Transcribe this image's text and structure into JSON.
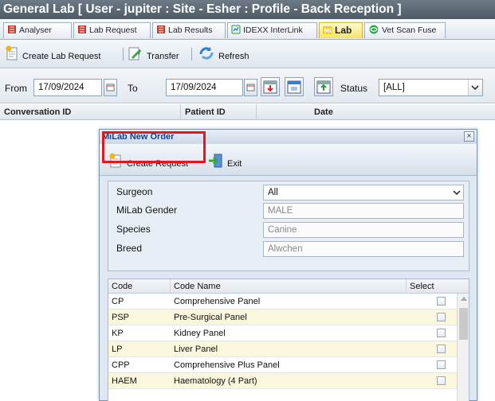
{
  "window": {
    "title": "General Lab [ User - jupiter : Site - Esher : Profile - Back Reception ]"
  },
  "tabs": [
    {
      "label": "Analyser"
    },
    {
      "label": "Lab Request"
    },
    {
      "label": "Lab Results"
    },
    {
      "label": "IDEXX InterLink"
    },
    {
      "label": "Lab",
      "active": true
    },
    {
      "label": "Vet Scan Fuse"
    }
  ],
  "toolbar": {
    "create_label": "Create Lab Request",
    "transfer_label": "Transfer",
    "refresh_label": "Refresh"
  },
  "filter": {
    "from_label": "From",
    "from_value": "17/09/2024",
    "to_label": "To",
    "to_value": "17/09/2024",
    "status_label": "Status",
    "status_value": "[ALL]"
  },
  "grid": {
    "columns": [
      "Conversation ID",
      "Patient ID",
      "Date"
    ]
  },
  "dialog": {
    "title": "MiLab New Order",
    "create_label": "Create Request",
    "exit_label": "Exit",
    "form": {
      "surgeon_label": "Surgeon",
      "surgeon_value": "All",
      "gender_label": "MiLab Gender",
      "gender_value": "MALE",
      "species_label": "Species",
      "species_value": "Canine",
      "breed_label": "Breed",
      "breed_value": "Alwchen"
    },
    "table": {
      "columns": [
        "Code",
        "Code Name",
        "Select"
      ],
      "rows": [
        {
          "code": "CP",
          "name": "Comprehensive Panel"
        },
        {
          "code": "PSP",
          "name": "Pre-Surgical Panel"
        },
        {
          "code": "KP",
          "name": "Kidney Panel"
        },
        {
          "code": "LP",
          "name": "Liver Panel"
        },
        {
          "code": "CPP",
          "name": "Comprehensive Plus Panel"
        },
        {
          "code": "HAEM",
          "name": "Haematology (4 Part)"
        }
      ]
    }
  },
  "colors": {
    "highlight": "#e8141e",
    "alt_row": "#fbf7dc",
    "dialog_title": "#15428b"
  }
}
